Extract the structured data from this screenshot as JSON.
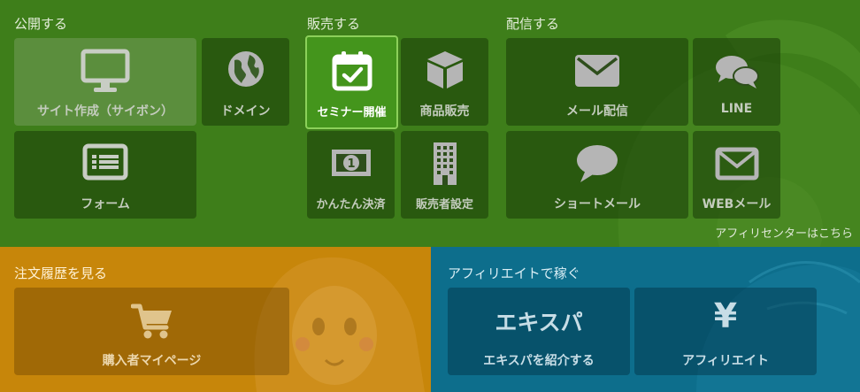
{
  "publish": {
    "title": "公開する",
    "site_label": "サイト作成（サイボン）",
    "domain_label": "ドメイン",
    "form_label": "フォーム"
  },
  "sell": {
    "title": "販売する",
    "seminar_label": "セミナー開催",
    "product_label": "商品販売",
    "payment_label": "かんたん決済",
    "seller_label": "販売者設定"
  },
  "deliver": {
    "title": "配信する",
    "mail_label": "メール配信",
    "line_label": "LINE",
    "short_label": "ショートメール",
    "web_label": "WEBメール"
  },
  "affiliate_center_link": "アフィリセンターはこちら",
  "orders": {
    "title": "注文履歴を見る",
    "mypage_label": "購入者マイページ"
  },
  "affiliate": {
    "title": "アフィリエイトで稼ぐ",
    "exispa_logo": "エキスパ",
    "exispa_label": "エキスパを紹介する",
    "yen_symbol": "¥",
    "affiliate_label": "アフィリエイト"
  },
  "colors": {
    "green_panel": "#3e7e1a",
    "orange_panel": "#c7860a",
    "blue_panel": "#0d6e8c",
    "active_tile": "#44951c",
    "icon_gray": "#b5b5b5"
  }
}
